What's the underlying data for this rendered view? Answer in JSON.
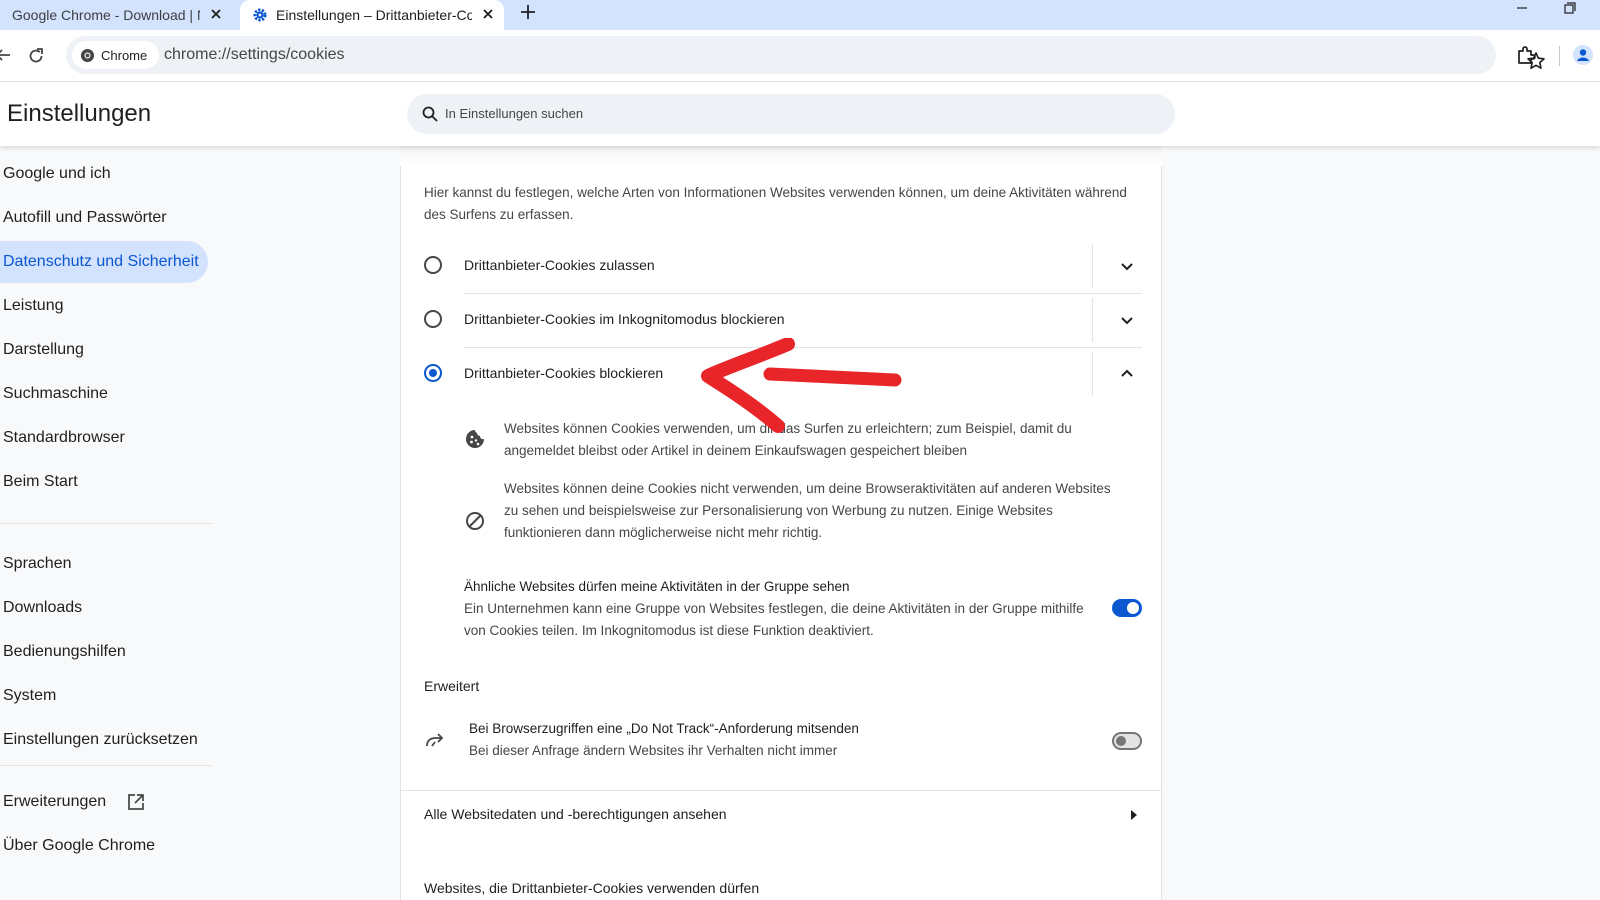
{
  "tabs": [
    {
      "title": "Google Chrome - Download | N",
      "active": false
    },
    {
      "title": "Einstellungen – Drittanbieter-Cookies",
      "active": true
    }
  ],
  "omnibox": {
    "chip_label": "Chrome",
    "url": "chrome://settings/cookies"
  },
  "header": {
    "title": "Einstellungen",
    "search_placeholder": "In Einstellungen suchen"
  },
  "sidebar": {
    "items": [
      {
        "label": "Google und ich",
        "active": false
      },
      {
        "label": "Autofill und Passwörter",
        "active": false
      },
      {
        "label": "Datenschutz und Sicherheit",
        "active": true
      },
      {
        "label": "Leistung",
        "active": false
      },
      {
        "label": "Darstellung",
        "active": false
      },
      {
        "label": "Suchmaschine",
        "active": false
      },
      {
        "label": "Standardbrowser",
        "active": false
      },
      {
        "label": "Beim Start",
        "active": false
      },
      {
        "label": "Sprachen",
        "active": false
      },
      {
        "label": "Downloads",
        "active": false
      },
      {
        "label": "Bedienungshilfen",
        "active": false
      },
      {
        "label": "System",
        "active": false
      },
      {
        "label": "Einstellungen zurücksetzen",
        "active": false
      },
      {
        "label": "Erweiterungen",
        "active": false
      },
      {
        "label": "Über Google Chrome",
        "active": false
      }
    ]
  },
  "main": {
    "description": "Hier kannst du festlegen, welche Arten von Informationen Websites verwenden können, um deine Aktivitäten während des Surfens zu erfassen.",
    "options": [
      {
        "label": "Drittanbieter-Cookies zulassen",
        "checked": false,
        "expanded": false
      },
      {
        "label": "Drittanbieter-Cookies im Inkognitomodus blockieren",
        "checked": false,
        "expanded": false
      },
      {
        "label": "Drittanbieter-Cookies blockieren",
        "checked": true,
        "expanded": true
      }
    ],
    "details": [
      {
        "icon": "cookie-icon",
        "text": "Websites können Cookies verwenden, um dir das Surfen zu erleichtern; zum Beispiel, damit du angemeldet bleibst oder Artikel in deinem Einkaufswagen gespeichert bleiben"
      },
      {
        "icon": "block-icon",
        "text": "Websites können deine Cookies nicht verwenden, um deine Browseraktivitäten auf anderen Websites zu sehen und beispielsweise zur Personalisierung von Werbung zu nutzen. Einige Websites funktionieren dann möglicherweise nicht mehr richtig."
      }
    ],
    "related_sites": {
      "title": "Ähnliche Websites dürfen meine Aktivitäten in der Gruppe sehen",
      "subtitle": "Ein Unternehmen kann eine Gruppe von Websites festlegen, die deine Aktivitäten in der Gruppe mithilfe von Cookies teilen. Im Inkognitomodus ist diese Funktion deaktiviert.",
      "enabled": true
    },
    "advanced_heading": "Erweitert",
    "do_not_track": {
      "title": "Bei Browserzugriffen eine „Do Not Track“-Anforderung mitsenden",
      "subtitle": "Bei dieser Anfrage ändern Websites ihr Verhalten nicht immer",
      "enabled": false
    },
    "all_site_data_link": "Alle Websitedaten und -berechtigungen ansehen",
    "allowed_sites_heading": "Websites, die Drittanbieter-Cookies verwenden dürfen"
  },
  "colors": {
    "accent": "#0b57d0",
    "tabstrip": "#d3e3fd",
    "annotation_arrow": "#e8262a"
  }
}
